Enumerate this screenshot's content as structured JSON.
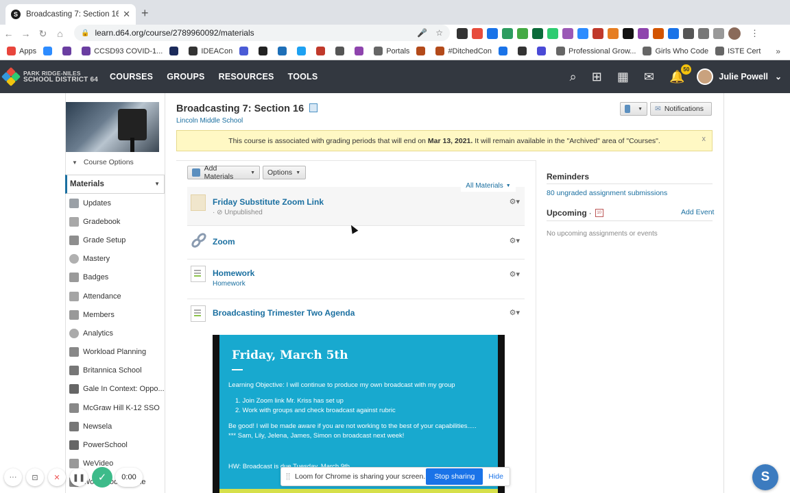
{
  "browser": {
    "tab_title": "Broadcasting 7: Section 16 | Sc",
    "tab_favicon": "S",
    "url": "learn.d64.org/course/2789960092/materials",
    "bookmarks": [
      {
        "label": "Apps",
        "color": "#e8453c"
      },
      {
        "label": "",
        "color": "#2d8cff"
      },
      {
        "label": "",
        "color": "#6a3ea1"
      },
      {
        "label": "CCSD93 COVID-1...",
        "color": "#6a3ea1"
      },
      {
        "label": "",
        "color": "#1b2a5a"
      },
      {
        "label": "IDEACon",
        "color": "#333333"
      },
      {
        "label": "",
        "color": "#4a5bd6"
      },
      {
        "label": "",
        "color": "#222222"
      },
      {
        "label": "",
        "color": "#1d6fb8"
      },
      {
        "label": "",
        "color": "#1da1f2"
      },
      {
        "label": "",
        "color": "#c0392b"
      },
      {
        "label": "",
        "color": "#555555"
      },
      {
        "label": "",
        "color": "#8e44ad"
      },
      {
        "label": "Portals",
        "color": "#666666"
      },
      {
        "label": "",
        "color": "#b34a1a"
      },
      {
        "label": "#DitchedCon",
        "color": "#b34a1a"
      },
      {
        "label": "",
        "color": "#1a73e8"
      },
      {
        "label": "",
        "color": "#333333"
      },
      {
        "label": "",
        "color": "#4a4ad6"
      },
      {
        "label": "Professional Grow...",
        "color": "#666666"
      },
      {
        "label": "Girls Who Code",
        "color": "#666666"
      },
      {
        "label": "ISTE Cert",
        "color": "#666666"
      }
    ],
    "more": "»"
  },
  "header": {
    "logo_line1": "PARK RIDGE-NILES",
    "logo_line2": "SCHOOL DISTRICT 64",
    "nav": [
      "COURSES",
      "GROUPS",
      "RESOURCES",
      "TOOLS"
    ],
    "notification_count": "50",
    "user_name": "Julie Powell"
  },
  "course": {
    "title": "Broadcasting 7: Section 16",
    "school": "Lincoln Middle School",
    "options_label": "Course Options",
    "notifications_label": "Notifications"
  },
  "banner": {
    "text_before": "This course is associated with grading periods that will end on",
    "date": "Mar 13, 2021.",
    "text_after": "It will remain available in the \"Archived\" area of \"Courses\".",
    "close": "x"
  },
  "sidebar": {
    "items": [
      {
        "label": "Materials",
        "active": true
      },
      {
        "label": "Updates"
      },
      {
        "label": "Gradebook"
      },
      {
        "label": "Grade Setup"
      },
      {
        "label": "Mastery"
      },
      {
        "label": "Badges"
      },
      {
        "label": "Attendance"
      },
      {
        "label": "Members"
      },
      {
        "label": "Analytics"
      },
      {
        "label": "Workload Planning"
      },
      {
        "label": "Britannica School"
      },
      {
        "label": "Gale In Context: Oppo..."
      },
      {
        "label": "McGraw Hill K-12 SSO"
      },
      {
        "label": "Newsela"
      },
      {
        "label": "PowerSchool"
      },
      {
        "label": "WeVideo"
      },
      {
        "label": "World Book Online"
      }
    ]
  },
  "materials": {
    "add_label": "Add Materials",
    "options_label": "Options",
    "filter_label": "All Materials",
    "items": [
      {
        "title": "Friday Substitute Zoom Link",
        "sub": "Unpublished"
      },
      {
        "title": "Zoom",
        "sub": ""
      },
      {
        "title": "Homework",
        "sub": "Homework"
      },
      {
        "title": "Broadcasting Trimester Two Agenda",
        "sub": ""
      }
    ]
  },
  "slide": {
    "title": "Friday, March 5th",
    "objective": "Learning Objective: I will continue to produce my own broadcast with my group",
    "list": [
      "1.    Join Zoom link Mr. Kriss has set up",
      "2.    Work with groups and check broadcast against rubric"
    ],
    "note1": "Be good! I will be made aware if you are not working to the best of your capabilities.....",
    "note2": "*** Sam, Lily, Jelena, James, Simon on broadcast next week!",
    "hw": "HW: Broadcast is due Tuesday, March 9th"
  },
  "right": {
    "reminders_title": "Reminders",
    "ungraded": "80 ungraded assignment submissions",
    "upcoming_title": "Upcoming",
    "calendar_day": "10",
    "add_event": "Add Event",
    "no_upcoming": "No upcoming assignments or events"
  },
  "loom": {
    "sharing_text": "Loom for Chrome is sharing your screen.",
    "stop": "Stop sharing",
    "hide": "Hide",
    "timer": "0:00"
  },
  "chat_letter": "S"
}
